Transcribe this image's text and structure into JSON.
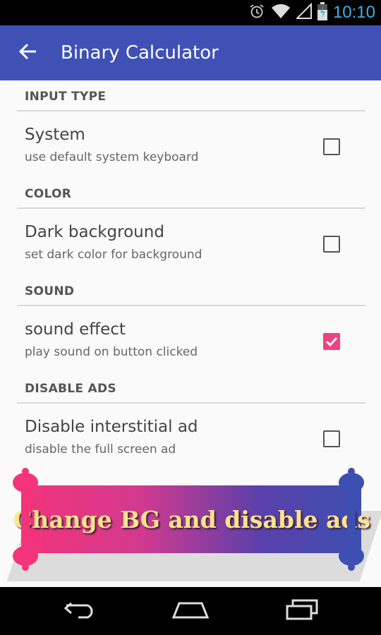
{
  "status_bar": {
    "time": "10:10",
    "icons": [
      "alarm-icon",
      "wifi-icon",
      "cell-signal-icon",
      "battery-charging-icon"
    ],
    "time_color": "#33b5e5"
  },
  "app_bar": {
    "title": "Binary Calculator",
    "color": "#3f51b5",
    "back_icon": "arrow-back-icon"
  },
  "sections": [
    {
      "header": "INPUT TYPE",
      "pref": {
        "title": "System",
        "summary": "use default system keyboard",
        "checked": false
      }
    },
    {
      "header": "COLOR",
      "pref": {
        "title": "Dark background",
        "summary": "set dark color for background",
        "checked": false
      }
    },
    {
      "header": "SOUND",
      "pref": {
        "title": "sound effect",
        "summary": "play sound on button clicked",
        "checked": true
      }
    },
    {
      "header": "DISABLE ADS",
      "pref": {
        "title": "Disable interstitial ad",
        "summary": "disable the full screen ad",
        "checked": false
      }
    }
  ],
  "banner": {
    "text": "Change BG and disable ads",
    "accent_left": "#f3347a",
    "accent_right": "#3d4fb0"
  },
  "checkbox_accent": "#ef4081",
  "nav_bar": {
    "icons": [
      "back-nav-icon",
      "home-nav-icon",
      "recents-nav-icon"
    ]
  }
}
